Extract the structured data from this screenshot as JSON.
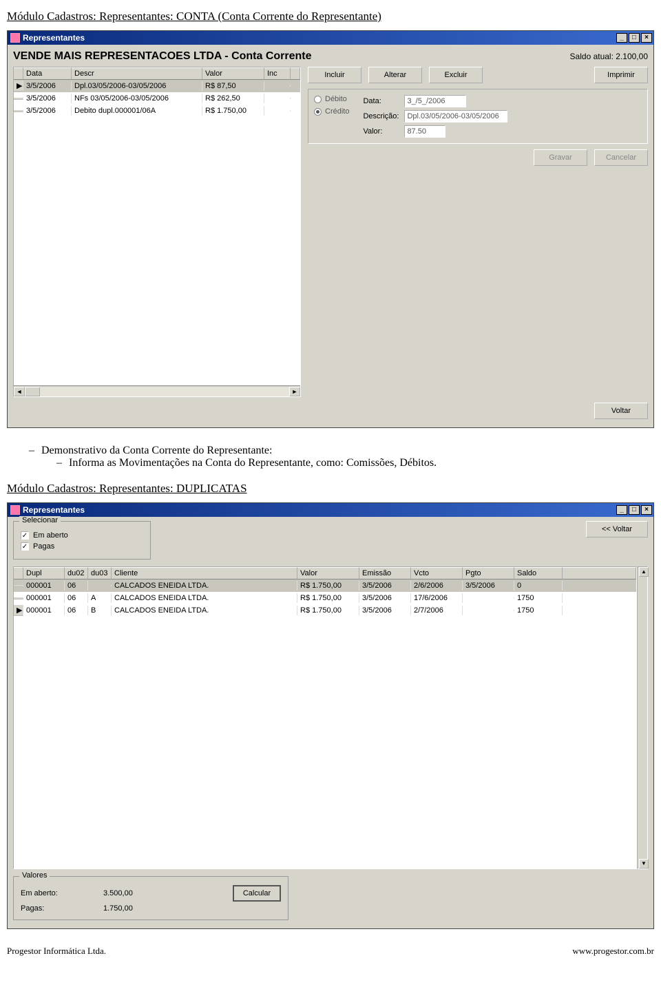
{
  "doc_heading_1": "Módulo Cadastros: Representantes: CONTA (Conta Corrente do Representante)",
  "window1": {
    "title": "Representantes",
    "subtitle": "VENDE MAIS REPRESENTACOES LTDA - Conta Corrente",
    "saldo_label": "Saldo atual:",
    "saldo_value": "2.100,00",
    "grid": {
      "headers": [
        "Data",
        "Descr",
        "Valor",
        "Inc"
      ],
      "rows": [
        {
          "marker": "▶",
          "data": "3/5/2006",
          "descr": "Dpl.03/05/2006-03/05/2006",
          "valor": "R$ 87,50",
          "inc": ""
        },
        {
          "marker": "",
          "data": "3/5/2006",
          "descr": "NFs 03/05/2006-03/05/2006",
          "valor": "R$ 262,50",
          "inc": ""
        },
        {
          "marker": "",
          "data": "3/5/2006",
          "descr": "Debito dupl.000001/06A",
          "valor": "R$ 1.750,00",
          "inc": ""
        }
      ]
    },
    "buttons": {
      "incluir": "Incluir",
      "alterar": "Alterar",
      "excluir": "Excluir",
      "imprimir": "Imprimir",
      "gravar": "Gravar",
      "cancelar": "Cancelar",
      "voltar": "Voltar"
    },
    "radios": {
      "debito": "Débito",
      "credito": "Crédito"
    },
    "fields": {
      "data_label": "Data:",
      "data_value": "3_/5_/2006",
      "descricao_label": "Descrição:",
      "descricao_value": "Dpl.03/05/2006-03/05/2006",
      "valor_label": "Valor:",
      "valor_value": "87.50"
    }
  },
  "bullets": {
    "line1": "Demonstrativo da Conta Corrente do Representante:",
    "line2": "Informa as Movimentações na Conta do Representante, como: Comissões, Débitos."
  },
  "doc_heading_2": "Módulo Cadastros: Representantes: DUPLICATAS",
  "window2": {
    "title": "Representantes",
    "selecionar_legend": "Selecionar",
    "chk_emaberto": "Em aberto",
    "chk_pagas": "Pagas",
    "btn_voltar": "<< Voltar",
    "grid": {
      "headers": [
        "Dupl",
        "du02",
        "du03",
        "Cliente",
        "Valor",
        "Emissão",
        "Vcto",
        "Pgto",
        "Saldo"
      ],
      "rows": [
        {
          "marker": "",
          "dupl": "000001",
          "du02": "06",
          "du03": "",
          "cliente": "CALCADOS ENEIDA LTDA.",
          "valor": "R$ 1.750,00",
          "emissao": "3/5/2006",
          "vcto": "2/6/2006",
          "pgto": "3/5/2006",
          "saldo": "0"
        },
        {
          "marker": "",
          "dupl": "000001",
          "du02": "06",
          "du03": "A",
          "cliente": "CALCADOS ENEIDA LTDA.",
          "valor": "R$ 1.750,00",
          "emissao": "3/5/2006",
          "vcto": "17/6/2006",
          "pgto": "",
          "saldo": "1750"
        },
        {
          "marker": "▶",
          "dupl": "000001",
          "du02": "06",
          "du03": "B",
          "cliente": "CALCADOS ENEIDA LTDA.",
          "valor": "R$ 1.750,00",
          "emissao": "3/5/2006",
          "vcto": "2/7/2006",
          "pgto": "",
          "saldo": "1750"
        }
      ]
    },
    "valores": {
      "legend": "Valores",
      "emaberto_label": "Em aberto:",
      "emaberto_value": "3.500,00",
      "pagas_label": "Pagas:",
      "pagas_value": "1.750,00",
      "btn_calcular": "Calcular"
    }
  },
  "footer": {
    "left": "Progestor Informática Ltda.",
    "right": "www.progestor.com.br"
  }
}
